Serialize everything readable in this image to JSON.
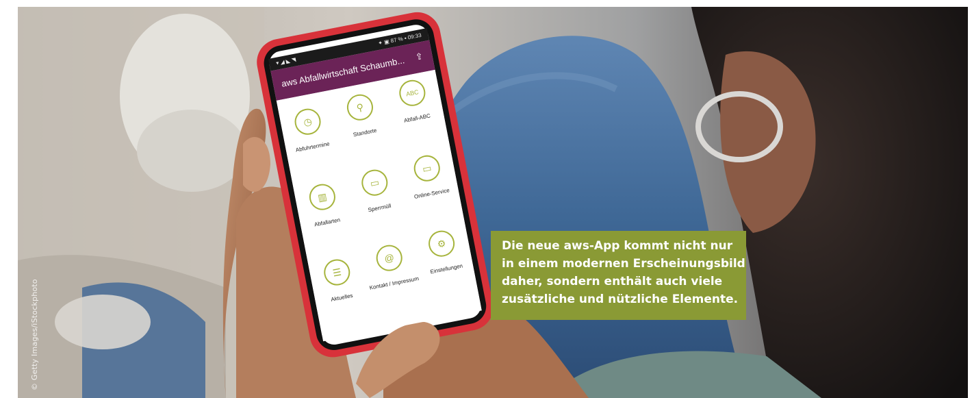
{
  "photo_credit": "© Getty Images/iStockphoto",
  "phone": {
    "status_left": "▾ ◢ ◣ ◥",
    "status_right": "✦ ▣ 87 % ▪ 09:33",
    "app_title": "aws Abfallwirtschaft Schaumb...",
    "share_icon": "share-icon",
    "tiles": [
      {
        "label": "Abfuhrtermine",
        "icon": "clock-icon",
        "glyph": "◷"
      },
      {
        "label": "Standorte",
        "icon": "location-pin-icon",
        "glyph": "⚲"
      },
      {
        "label": "Abfall-ABC",
        "icon": "abc-icon",
        "glyph": "ABC"
      },
      {
        "label": "Abfallarten",
        "icon": "trash-bin-icon",
        "glyph": "▥"
      },
      {
        "label": "Sperrmüll",
        "icon": "sofa-icon",
        "glyph": "▭"
      },
      {
        "label": "Online-Service",
        "icon": "laptop-icon",
        "glyph": "▭"
      },
      {
        "label": "Aktuelles",
        "icon": "news-icon",
        "glyph": "☰"
      },
      {
        "label": "Kontakt / Impressum",
        "icon": "at-icon",
        "glyph": "@"
      },
      {
        "label": "Einstellungen",
        "icon": "gear-icon",
        "glyph": "⚙"
      }
    ]
  },
  "caption": {
    "lines": [
      "Die neue aws-App kommt nicht nur",
      "in einem modernen Erscheinungsbild",
      "daher, sondern enthält auch viele",
      "zusätzliche und nützliche Elemente."
    ]
  },
  "colors": {
    "caption_bg": "#8a9a35",
    "app_bar": "#6b2357",
    "icon_accent": "#a6b43c",
    "phone_case": "#d8323a",
    "jeans": "#3a5f8e"
  }
}
